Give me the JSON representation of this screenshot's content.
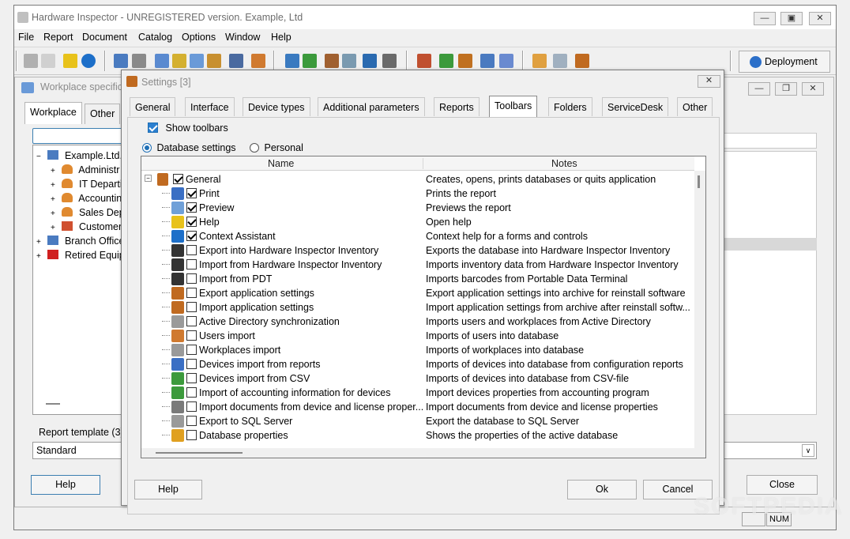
{
  "app": {
    "title": "Hardware Inspector - UNREGISTERED version. Example, Ltd",
    "menu": [
      "File",
      "Report",
      "Document",
      "Catalog",
      "Options",
      "Window",
      "Help"
    ],
    "toolbar": {
      "deployment_label": "Deployment"
    },
    "status": {
      "num": "NUM"
    },
    "watermark": "SOFTPEDIA"
  },
  "workplace_window": {
    "title": "Workplace specifica",
    "tabs": [
      "Workplace",
      "Other"
    ],
    "tree": [
      {
        "label": "Example.Ltd.",
        "icon": "network-icon",
        "level": 0,
        "expander": "−"
      },
      {
        "label": "Administr",
        "icon": "users-icon",
        "level": 1,
        "expander": "+"
      },
      {
        "label": "IT Departi",
        "icon": "users-icon",
        "level": 1,
        "expander": "+"
      },
      {
        "label": "Accountin",
        "icon": "users-icon",
        "level": 1,
        "expander": "+"
      },
      {
        "label": "Sales Dep",
        "icon": "users-icon",
        "level": 1,
        "expander": "+"
      },
      {
        "label": "Customer",
        "icon": "home-icon",
        "level": 1,
        "expander": "+"
      },
      {
        "label": "Branch Office",
        "icon": "network-icon",
        "level": 0,
        "expander": "+"
      },
      {
        "label": "Retired Equip",
        "icon": "retired-icon",
        "level": 0,
        "expander": "+"
      }
    ],
    "report_template_label": "Report template (3)",
    "report_template_value": "Standard",
    "help_label": "Help",
    "close_label": "Close"
  },
  "settings": {
    "title": "Settings [3]",
    "tabs": [
      "General",
      "Interface",
      "Device types",
      "Additional parameters",
      "Reports",
      "Toolbars",
      "Folders",
      "ServiceDesk",
      "Other"
    ],
    "active_tab": "Toolbars",
    "show_toolbars_label": "Show toolbars",
    "show_toolbars_checked": true,
    "radio": {
      "database": "Database settings",
      "personal": "Personal",
      "selected": "database"
    },
    "grid": {
      "col_name": "Name",
      "col_notes": "Notes",
      "root": {
        "name": "General",
        "note": "Creates, opens, prints databases or quits application",
        "checked": true
      },
      "rows": [
        {
          "name": "Print",
          "note": "Prints the report",
          "checked": true,
          "icon": "print-icon",
          "color": "#3a6fc4"
        },
        {
          "name": "Preview",
          "note": "Previews the report",
          "checked": true,
          "icon": "preview-icon",
          "color": "#6fa0d8"
        },
        {
          "name": "Help",
          "note": "Open help",
          "checked": true,
          "icon": "help-icon",
          "color": "#e8c21a"
        },
        {
          "name": "Context Assistant",
          "note": "Context help for a forms and controls",
          "checked": true,
          "icon": "info-icon",
          "color": "#1d6fc9"
        },
        {
          "name": "Export into Hardware Inspector Inventory",
          "note": "Exports the database into Hardware Inspector Inventory",
          "checked": false,
          "icon": "barcode-icon",
          "color": "#333333"
        },
        {
          "name": "Import from Hardware Inspector Inventory",
          "note": "Imports inventory data from Hardware Inspector Inventory",
          "checked": false,
          "icon": "barcode-icon",
          "color": "#333333"
        },
        {
          "name": "Import from PDT",
          "note": "Imports barcodes from Portable Data Terminal",
          "checked": false,
          "icon": "barcode-icon",
          "color": "#333333"
        },
        {
          "name": "Export application settings",
          "note": "Export application settings into archive for reinstall software",
          "checked": false,
          "icon": "tools-icon",
          "color": "#c06a20"
        },
        {
          "name": "Import application settings",
          "note": "Import application settings from archive after reinstall softw...",
          "checked": false,
          "icon": "tools-icon",
          "color": "#c06a20"
        },
        {
          "name": "Active Directory synchronization",
          "note": "Imports users and workplaces from Active Directory",
          "checked": false,
          "icon": "database-icon",
          "color": "#9a9a9a"
        },
        {
          "name": "Users import",
          "note": "Imports of users into database",
          "checked": false,
          "icon": "user-import-icon",
          "color": "#d07a30"
        },
        {
          "name": "Workplaces import",
          "note": "Imports of workplaces into database",
          "checked": false,
          "icon": "database-icon",
          "color": "#9a9a9a"
        },
        {
          "name": "Devices import from reports",
          "note": "Imports of devices into database from configuration reports",
          "checked": false,
          "icon": "devices-icon",
          "color": "#3a6fc4"
        },
        {
          "name": "Devices import from CSV",
          "note": "Imports of devices into database from CSV-file",
          "checked": false,
          "icon": "csv-icon",
          "color": "#3c9a3c"
        },
        {
          "name": "Import of accounting information for devices",
          "note": "Import devices properties from accounting program",
          "checked": false,
          "icon": "accounting-icon",
          "color": "#3c9a3c"
        },
        {
          "name": "Import documents from device and license proper...",
          "note": "Import documents from device and license properties",
          "checked": false,
          "icon": "documents-icon",
          "color": "#7a7a7a"
        },
        {
          "name": "Export to SQL Server",
          "note": "Export the database to SQL Server",
          "checked": false,
          "icon": "sql-icon",
          "color": "#9a9a9a"
        },
        {
          "name": "Database properties",
          "note": "Shows the properties of the active database",
          "checked": false,
          "icon": "db-properties-icon",
          "color": "#e0a020"
        }
      ]
    },
    "buttons": {
      "help": "Help",
      "ok": "Ok",
      "cancel": "Cancel"
    }
  }
}
